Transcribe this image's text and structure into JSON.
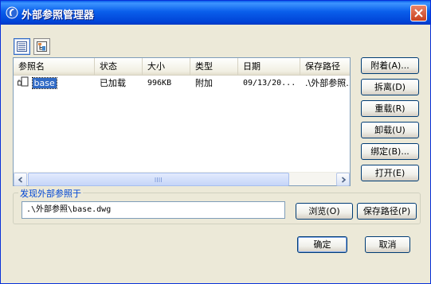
{
  "window": {
    "title": "外部参照管理器"
  },
  "columns": [
    "参照名",
    "状态",
    "大小",
    "类型",
    "日期",
    "保存路径"
  ],
  "rows": [
    {
      "name": "base",
      "status": "已加载",
      "size": "996KB",
      "type": "附加",
      "date": "09/13/20...",
      "path": ".\\外部参照..."
    }
  ],
  "side_buttons": {
    "attach": "附着(A)...",
    "detach": "拆离(D)",
    "reload": "重载(R)",
    "unload": "卸载(U)",
    "bind": "绑定(B)...",
    "open": "打开(E)"
  },
  "found_at": {
    "label": "发现外部参照于",
    "value": ".\\外部参照\\base.dwg",
    "browse": "浏览(O)",
    "save_path": "保存路径(P)"
  },
  "footer": {
    "ok": "确定",
    "cancel": "取消"
  },
  "colors": {
    "titlebar": "#0A5FEB",
    "selection": "#316AC5",
    "face": "#ECE9D8",
    "group_label": "#0046D5"
  }
}
